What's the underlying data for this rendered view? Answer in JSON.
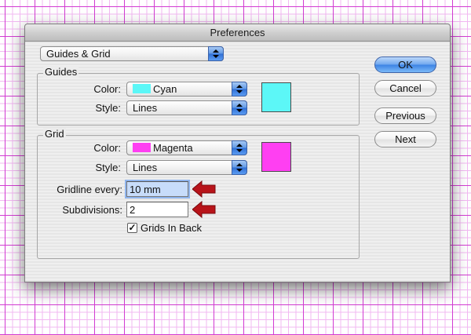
{
  "window": {
    "title": "Preferences"
  },
  "section_popup": {
    "value": "Guides & Grid"
  },
  "guides": {
    "label": "Guides",
    "color_label": "Color:",
    "color_value": "Cyan",
    "color_hex": "#5cf7f7",
    "style_label": "Style:",
    "style_value": "Lines"
  },
  "grid": {
    "label": "Grid",
    "color_label": "Color:",
    "color_value": "Magenta",
    "color_hex": "#ff3ff2",
    "style_label": "Style:",
    "style_value": "Lines",
    "gridline_label": "Gridline every:",
    "gridline_value": "10 mm",
    "subdivisions_label": "Subdivisions:",
    "subdivisions_value": "2",
    "back_label": "Grids In Back",
    "back_checked": true
  },
  "buttons": {
    "ok": "OK",
    "cancel": "Cancel",
    "previous": "Previous",
    "next": "Next"
  },
  "colors": {
    "annotation_arrow": "#b8141a",
    "accent_blue": "#3c82e4"
  }
}
